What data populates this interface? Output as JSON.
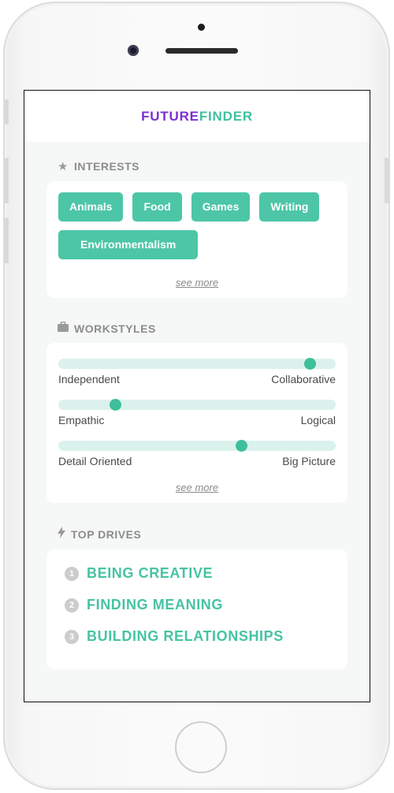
{
  "app": {
    "logo_part1": "FUTURE",
    "logo_part2": "FINDER"
  },
  "interests": {
    "title": "INTERESTS",
    "icon": "star-icon",
    "chips": [
      "Animals",
      "Food",
      "Games",
      "Writing",
      "Environmentalism"
    ],
    "see_more": "see more"
  },
  "workstyles": {
    "title": "WORKSTYLES",
    "icon": "briefcase-icon",
    "sliders": [
      {
        "left": "Independent",
        "right": "Collaborative",
        "value": 0.905
      },
      {
        "left": "Empathic",
        "right": "Logical",
        "value": 0.205
      },
      {
        "left": "Detail Oriented",
        "right": "Big Picture",
        "value": 0.66
      }
    ],
    "see_more": "see more"
  },
  "drives": {
    "title": "TOP DRIVES",
    "icon": "lightning-icon",
    "items": [
      {
        "num": "1",
        "label": "BEING CREATIVE"
      },
      {
        "num": "2",
        "label": "FINDING MEANING"
      },
      {
        "num": "3",
        "label": "BUILDING RELATIONSHIPS"
      }
    ]
  },
  "colors": {
    "accent": "#4cc6a7",
    "brand_purple": "#7a2fd3",
    "track": "#dbf2ec"
  }
}
